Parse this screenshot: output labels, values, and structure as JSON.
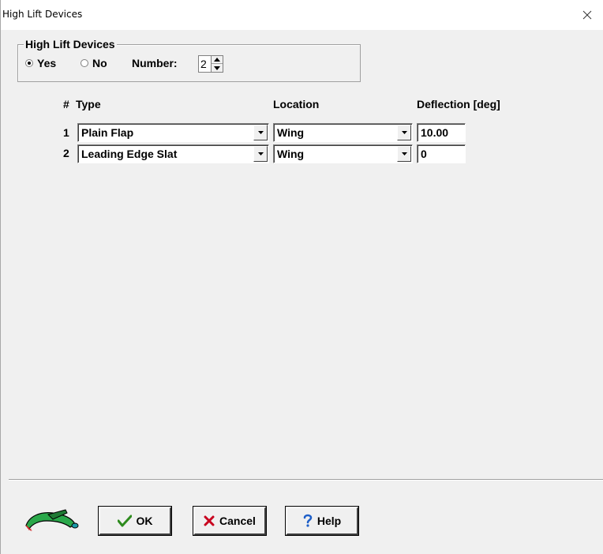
{
  "window": {
    "title": "High Lift Devices"
  },
  "group": {
    "legend": "High Lift Devices",
    "yes_label": "Yes",
    "no_label": "No",
    "selected": "Yes",
    "number_label": "Number:",
    "number_value": "2"
  },
  "table": {
    "headers": {
      "num": "#",
      "type": "Type",
      "location": "Location",
      "deflection": "Deflection [deg]"
    },
    "rows": [
      {
        "num": "1",
        "type": "Plain Flap",
        "location": "Wing",
        "deflection": "10.00"
      },
      {
        "num": "2",
        "type": "Leading Edge Slat",
        "location": "Wing",
        "deflection": "0"
      }
    ]
  },
  "buttons": {
    "ok": "OK",
    "cancel": "Cancel",
    "help": "Help"
  },
  "icons": {
    "close": "close-icon",
    "ok": "checkmark-icon",
    "cancel": "x-icon",
    "help": "question-icon",
    "logo": "airplane-logo-icon"
  },
  "colors": {
    "ok_check": "#2e8b1e",
    "cancel_x": "#c8001e",
    "help_q": "#1e5fc8",
    "logo_body": "#2aa84a"
  }
}
